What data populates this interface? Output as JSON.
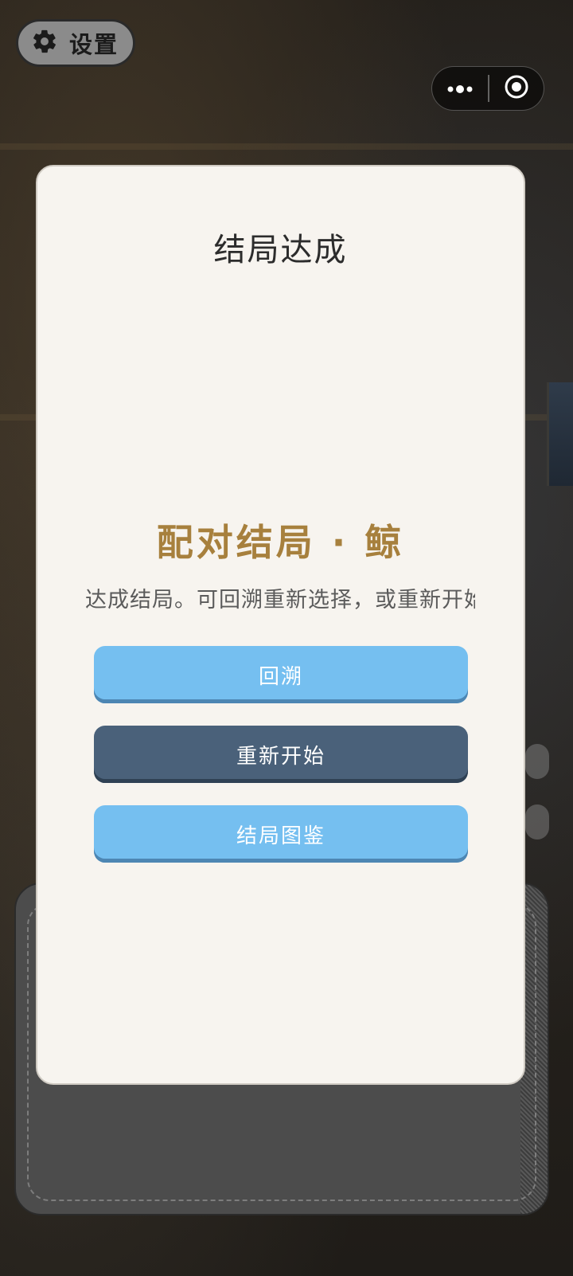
{
  "settings": {
    "label": "设置",
    "icon": "gear-icon"
  },
  "capsule": {
    "more_icon": "more-dots-icon",
    "close_icon": "target-circle-icon"
  },
  "modal": {
    "title": "结局达成",
    "ending_name": "配对结局 · 鲸",
    "description": "达成结局。可回溯重新选择，或重新开始",
    "buttons": {
      "rewind": "回溯",
      "restart": "重新开始",
      "gallery": "结局图鉴"
    }
  },
  "colors": {
    "accent_gold": "#a7803d",
    "button_light": "#75bff0",
    "button_dark": "#4a617a",
    "modal_bg": "#f7f4ef"
  }
}
